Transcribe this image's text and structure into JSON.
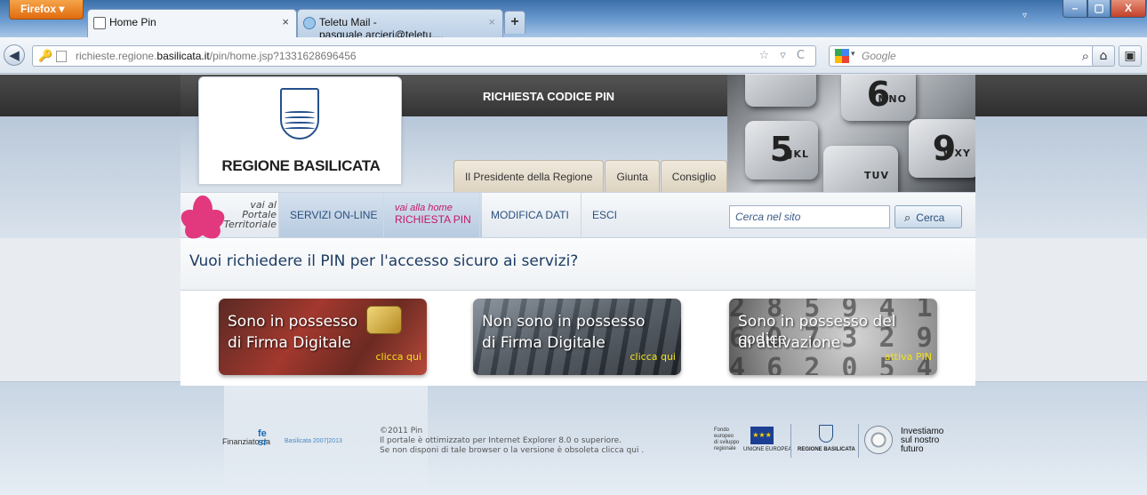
{
  "browser": {
    "menu_button": "Firefox ▾",
    "tabs": [
      {
        "label": "Home Pin",
        "close": "×"
      },
      {
        "label": "Teletu Mail - pasquale.arcieri@teletu....",
        "close": "×"
      }
    ],
    "new_tab": "+",
    "tab_list": "▿",
    "window_controls": {
      "minimize": "–",
      "maximize": "▢",
      "close": "X"
    },
    "url_prefix": "richieste.regione.",
    "url_domain": "basilicata.it",
    "url_suffix": "/pin/home.jsp?1331628696456",
    "url_actions": "☆ ▿ C",
    "search_engine_placeholder": "Google",
    "back": "◀"
  },
  "header": {
    "title": "RICHIESTA CODICE PIN",
    "logo_text": "REGIONE BASILICATA",
    "keypad_keys": [
      {
        "digit": "5",
        "letters": "JKL"
      },
      {
        "digit": "6",
        "letters": "MNO"
      },
      {
        "digit": "9",
        "letters": "WXY"
      },
      {
        "digit": "",
        "letters": "TUV"
      }
    ],
    "inst_tabs": [
      "Il Presidente della Regione",
      "Giunta",
      "Consiglio"
    ]
  },
  "menu": {
    "portale": [
      "vai al",
      "Portale",
      "Territoriale"
    ],
    "items": [
      {
        "label": "SERVIZI ON-LINE"
      },
      {
        "prefix": "vai alla home",
        "label": "RICHIESTA PIN"
      },
      {
        "label": "MODIFICA DATI"
      },
      {
        "label": "ESCI"
      }
    ],
    "search_placeholder": "Cerca nel sito",
    "search_button": "Cerca"
  },
  "main": {
    "question": "Vuoi richiedere il PIN per l'accesso sicuro ai servizi?",
    "banners": [
      {
        "line1": "Sono in possesso",
        "line2": "di Firma Digitale",
        "cta": "clicca qui"
      },
      {
        "line1": "Non sono in possesso",
        "line2": "di Firma Digitale",
        "cta": "clicca qui"
      },
      {
        "line1": "Sono in possesso del codice",
        "line2": "di attivazione",
        "cta": "attiva PIN"
      }
    ]
  },
  "footer": {
    "financed_by": "Finanziato da",
    "fesr_sub": "Basilicata 2007|2013",
    "copyright": "©2011 Pin",
    "note1": "Il portale è ottimizzato per Internet Explorer 8.0 o superiore.",
    "note2": "Se non disponi di tale browser o la versione è obsoleta clicca qui .",
    "fondo": [
      "Fondo",
      "europeo",
      "di sviluppo",
      "regionale"
    ],
    "eu_label": "UNIONE EUROPEA",
    "region_label": "REGIONE BASILICATA",
    "invest": [
      "Investiamo",
      "sul nostro",
      "futuro"
    ]
  }
}
